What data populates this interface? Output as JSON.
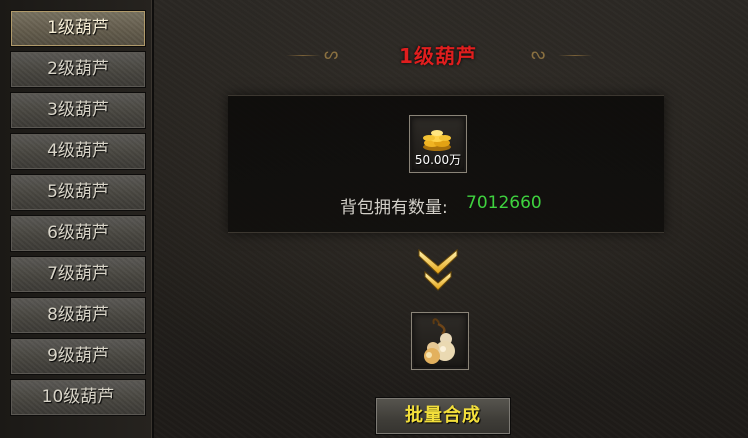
{
  "sidebar": {
    "items": [
      {
        "label": "1级葫芦"
      },
      {
        "label": "2级葫芦"
      },
      {
        "label": "3级葫芦"
      },
      {
        "label": "4级葫芦"
      },
      {
        "label": "5级葫芦"
      },
      {
        "label": "6级葫芦"
      },
      {
        "label": "7级葫芦"
      },
      {
        "label": "8级葫芦"
      },
      {
        "label": "9级葫芦"
      },
      {
        "label": "10级葫芦"
      }
    ],
    "active_index": 0
  },
  "main": {
    "title": "1级葫芦",
    "cost": {
      "icon": "gold-coins-icon",
      "amount": "50.00万"
    },
    "inventory": {
      "label": "背包拥有数量:",
      "value": "7012660"
    },
    "arrow_icon": "double-chevron-down-icon",
    "result": {
      "icon": "gourd-icon"
    },
    "batch_button": "批量合成"
  },
  "colors": {
    "title": "#e01e1e",
    "count": "#3fd23f",
    "button_text": "#f3df3b"
  }
}
